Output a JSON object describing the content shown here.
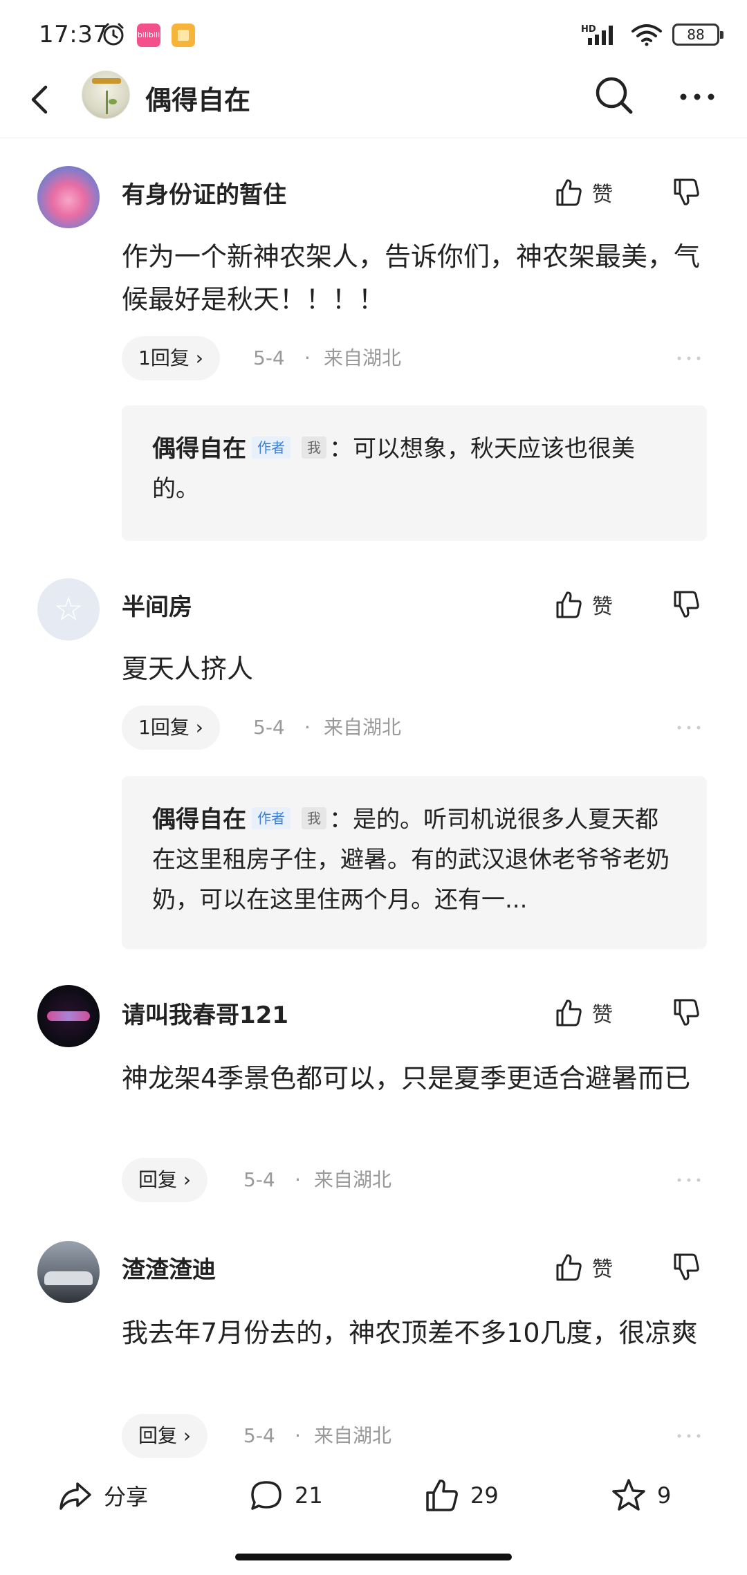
{
  "status_bar": {
    "time": "17:37",
    "network": "HD",
    "battery": "88",
    "app_icon_1": "bilibili"
  },
  "header": {
    "title": "偶得自在",
    "back_icon": "chevron-left-icon",
    "search_icon": "search-icon",
    "more_icon": "more-dots-icon"
  },
  "comments": [
    {
      "user": "有身份证的暂住",
      "text": "作为一个新神农架人，告诉你们，神农架最美，气候最好是秋天！！！！",
      "like_label": "赞",
      "reply_label": "1回复",
      "date": "5-4",
      "location": "来自湖北",
      "reply": {
        "author": "偶得自在",
        "author_badge": "作者",
        "me_badge": "我",
        "text": "：可以想象，秋天应该也很美的。"
      }
    },
    {
      "user": "半间房",
      "text": "夏天人挤人",
      "like_label": "赞",
      "reply_label": "1回复",
      "date": "5-4",
      "location": "来自湖北",
      "reply": {
        "author": "偶得自在",
        "author_badge": "作者",
        "me_badge": "我",
        "text": "：是的。听司机说很多人夏天都在这里租房子住，避暑。有的武汉退休老爷爷老奶奶，可以在这里住两个月。还有一..."
      }
    },
    {
      "user": "请叫我春哥121",
      "text": "神龙架4季景色都可以，只是夏季更适合避暑而已",
      "like_label": "赞",
      "reply_label": "回复",
      "date": "5-4",
      "location": "来自湖北"
    },
    {
      "user": "渣渣渣迪",
      "text": "我去年7月份去的，神农顶差不多10几度，很凉爽",
      "like_label": "赞",
      "reply_label": "回复",
      "date": "5-4",
      "location": "来自湖北"
    }
  ],
  "bottom_bar": {
    "share_label": "分享",
    "comment_count": "21",
    "like_count": "29",
    "favorite_count": "9"
  }
}
